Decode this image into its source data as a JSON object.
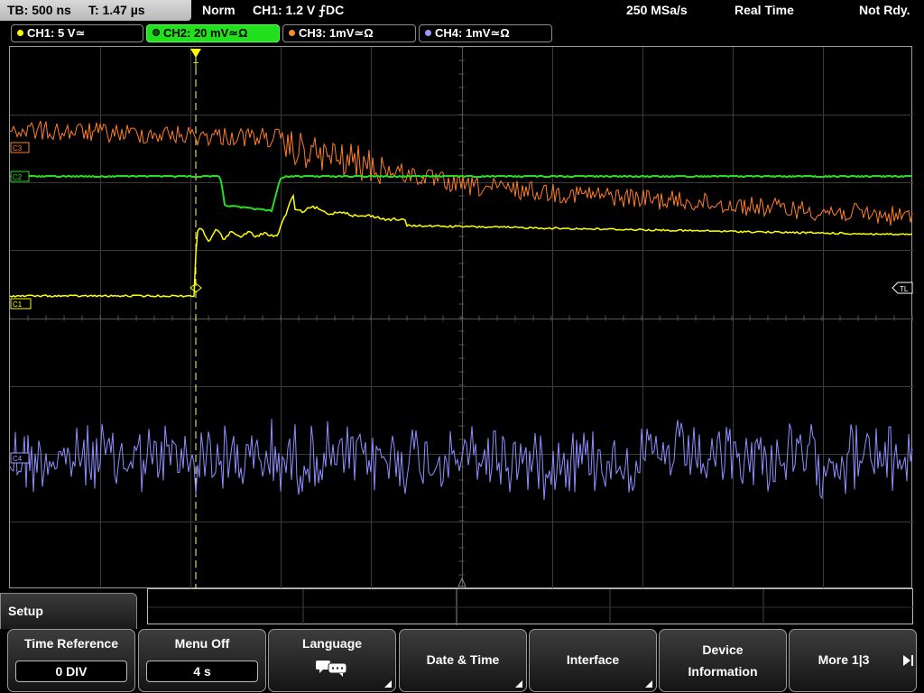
{
  "topbar": {
    "timebase": "TB: 500 ns",
    "trigger_time": "T: 1.47 µs",
    "mode": "Norm",
    "trigger": "CH1: 1.2 V ⨍DC",
    "sample_rate": "250 MSa/s",
    "acq": "Real Time",
    "status": "Not Rdy."
  },
  "channels": [
    {
      "label": "CH1: 5 V≃",
      "color": "#ffff00"
    },
    {
      "label": "CH2: 20 mV≃Ω",
      "color": "#22e01e"
    },
    {
      "label": "CH3: 1mV≃Ω",
      "color": "#ff8a2a"
    },
    {
      "label": "CH4: 1mV≃Ω",
      "color": "#9a9aff"
    }
  ],
  "markers": {
    "c1": "C1",
    "c2": "C2",
    "c3": "C3",
    "c4": "C4",
    "tl": "TL",
    "trigger_t": "T"
  },
  "menu": {
    "title": "Setup",
    "softkeys": {
      "time_reference": {
        "label": "Time Reference",
        "value": "0 DIV"
      },
      "menu_off": {
        "label": "Menu Off",
        "value": "4 s"
      },
      "language": {
        "label": "Language",
        "icon": "speech-bubble-icon"
      },
      "date_time": {
        "label": "Date & Time"
      },
      "interface": {
        "label": "Interface"
      },
      "device_info": {
        "label_line1": "Device",
        "label_line2": "Information"
      },
      "more": {
        "label": "More 1|3"
      }
    }
  }
}
